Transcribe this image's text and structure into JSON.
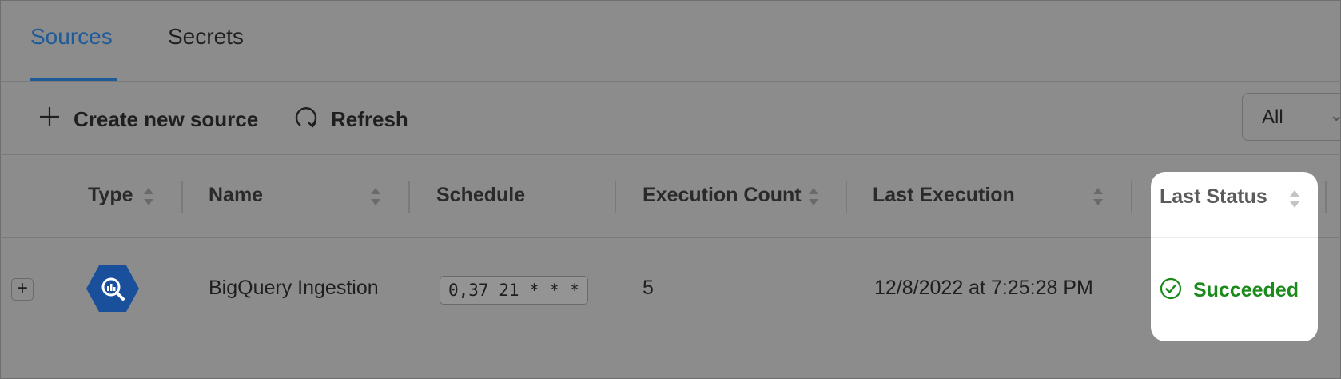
{
  "tabs": [
    {
      "label": "Sources",
      "active": true
    },
    {
      "label": "Secrets",
      "active": false
    }
  ],
  "toolbar": {
    "create_label": "Create new source",
    "refresh_label": "Refresh",
    "filter_value": "All"
  },
  "table": {
    "columns": [
      "Type",
      "Name",
      "Schedule",
      "Execution Count",
      "Last Execution",
      "Last Status"
    ],
    "rows": [
      {
        "type_icon": "bigquery-icon",
        "name": "BigQuery Ingestion",
        "schedule": "0,37 21 * * *",
        "execution_count": "5",
        "last_execution": "12/8/2022 at 7:25:28 PM",
        "last_status": "Succeeded"
      }
    ]
  },
  "colors": {
    "accent": "#1f5a99",
    "success": "#1a8a1a",
    "bigquery": "#1a4f9c"
  }
}
